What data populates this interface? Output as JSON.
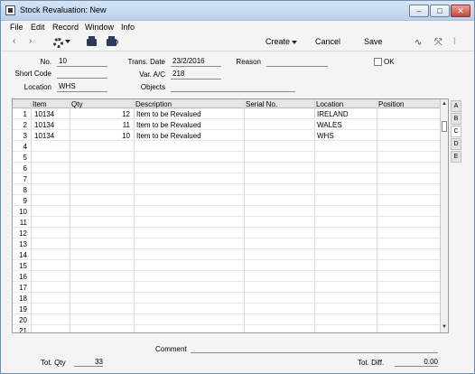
{
  "window": {
    "title": "Stock Revaluation: New"
  },
  "menu": [
    "File",
    "Edit",
    "Record",
    "Window",
    "Info"
  ],
  "toolbar": {
    "create": "Create",
    "cancel": "Cancel",
    "save": "Save"
  },
  "header": {
    "no_label": "No.",
    "no_value": "10",
    "short_code_label": "Short Code",
    "short_code_value": "",
    "location_label": "Location",
    "location_value": "WHS",
    "trans_date_label": "Trans. Date",
    "trans_date_value": "23/2/2016",
    "var_ac_label": "Var. A/C",
    "var_ac_value": "218",
    "objects_label": "Objects",
    "objects_value": "",
    "reason_label": "Reason",
    "reason_value": "",
    "ok_label": "OK"
  },
  "grid": {
    "columns": [
      "Item",
      "Qty",
      "Description",
      "Serial No.",
      "Location",
      "Position"
    ],
    "rows": [
      {
        "num": "1",
        "item": "10134",
        "qty": "12",
        "description": "Item to be Revalued",
        "serial": "",
        "location": "IRELAND",
        "position": ""
      },
      {
        "num": "2",
        "item": "10134",
        "qty": "11",
        "description": "Item to be Revalued",
        "serial": "",
        "location": "WALES",
        "position": ""
      },
      {
        "num": "3",
        "item": "10134",
        "qty": "10",
        "description": "Item to be Revalued",
        "serial": "",
        "location": "WHS",
        "position": ""
      },
      {
        "num": "4"
      },
      {
        "num": "5"
      },
      {
        "num": "6"
      },
      {
        "num": "7"
      },
      {
        "num": "8"
      },
      {
        "num": "9"
      },
      {
        "num": "10"
      },
      {
        "num": "11"
      },
      {
        "num": "12"
      },
      {
        "num": "13"
      },
      {
        "num": "14"
      },
      {
        "num": "15"
      },
      {
        "num": "16"
      },
      {
        "num": "17"
      },
      {
        "num": "18"
      },
      {
        "num": "19"
      },
      {
        "num": "20"
      },
      {
        "num": "21"
      }
    ]
  },
  "side_tabs": [
    "A",
    "B",
    "C",
    "D",
    "E"
  ],
  "footer": {
    "comment_label": "Comment",
    "comment_value": "",
    "tot_qty_label": "Tot. Qty",
    "tot_qty_value": "33",
    "tot_diff_label": "Tot. Diff.",
    "tot_diff_value": "0.00"
  }
}
